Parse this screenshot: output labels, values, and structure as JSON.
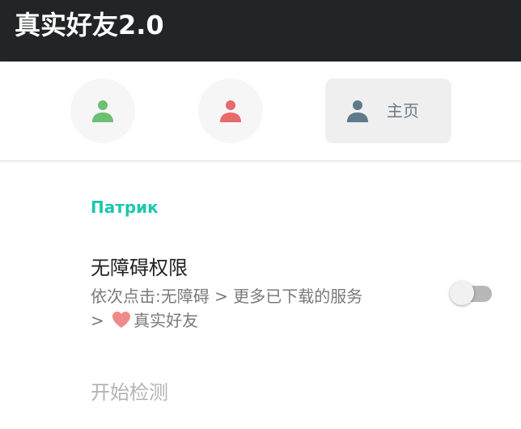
{
  "app": {
    "title": "真实好友2.0"
  },
  "nav": {
    "tabs": [
      {
        "icon": "person-icon",
        "color": "#6dbf73"
      },
      {
        "icon": "person-icon",
        "color": "#e66b6b"
      },
      {
        "icon": "person-icon",
        "color": "#5f7a8a",
        "label": "主页",
        "selected": true
      }
    ]
  },
  "section": {
    "title": "Патрик"
  },
  "accessibility": {
    "title": "无障碍权限",
    "subtitle_line1": "依次点击:无障碍 > 更多已下载的服务",
    "subtitle_prefix": ">",
    "subtitle_icon": "heart-icon",
    "subtitle_suffix": "真实好友",
    "toggle_enabled": false
  },
  "actions": {
    "start_detection": "开始检测"
  },
  "colors": {
    "appbar": "#212526",
    "accent": "#1dc7ad",
    "heart": "#f08a8a"
  }
}
